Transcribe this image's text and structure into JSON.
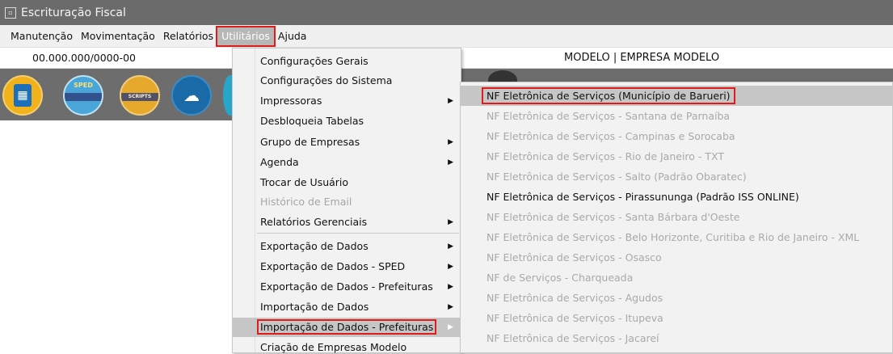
{
  "window": {
    "title": "Escrituração Fiscal",
    "icon": "app-window-icon"
  },
  "menubar": {
    "items": [
      {
        "label": "Manutenção"
      },
      {
        "label": "Movimentação"
      },
      {
        "label": "Relatórios"
      },
      {
        "label": "Utilitários",
        "active": true
      },
      {
        "label": "Ajuda"
      }
    ]
  },
  "info": {
    "cnpj": "00.000.000/0000-00",
    "empresa": "MODELO | EMPRESA MODELO"
  },
  "toolbar": {
    "buttons": [
      {
        "icon": "building-icon"
      },
      {
        "icon": "sped-contribuicoes-icon",
        "label": "SPED"
      },
      {
        "icon": "efd-icon",
        "label": "SCRIPTS"
      },
      {
        "icon": "cloud-download-icon"
      },
      {
        "icon": "partial-app-icon"
      }
    ]
  },
  "utilitarios_menu": [
    {
      "label": "Configurações Gerais",
      "disabled": false,
      "submenu": false
    },
    {
      "label": "Configurações do Sistema",
      "disabled": false,
      "submenu": false
    },
    {
      "label": "Impressoras",
      "disabled": false,
      "submenu": true
    },
    {
      "label": "Desbloqueia Tabelas",
      "disabled": false,
      "submenu": false
    },
    {
      "label": "Grupo de Empresas",
      "disabled": false,
      "submenu": true
    },
    {
      "label": "Agenda",
      "disabled": false,
      "submenu": true
    },
    {
      "label": "Trocar de Usuário",
      "disabled": false,
      "submenu": false
    },
    {
      "label": "Histórico de Email",
      "disabled": true,
      "submenu": false
    },
    {
      "label": "Relatórios Gerenciais",
      "disabled": false,
      "submenu": true
    },
    {
      "label": "Exportação de Dados",
      "disabled": false,
      "submenu": true
    },
    {
      "label": "Exportação de Dados - SPED",
      "disabled": false,
      "submenu": true
    },
    {
      "label": "Exportação de Dados - Prefeituras",
      "disabled": false,
      "submenu": true
    },
    {
      "label": "Importação de Dados",
      "disabled": false,
      "submenu": true
    },
    {
      "label": "Importação de Dados - Prefeituras",
      "disabled": false,
      "submenu": true,
      "highlighted": true
    },
    {
      "label": "Criação de Empresas Modelo",
      "disabled": false,
      "submenu": false
    }
  ],
  "prefeituras_submenu": [
    {
      "label": "NF Eletrônica de Serviços (Município de Barueri)",
      "disabled": false,
      "highlighted": true
    },
    {
      "label": "NF Eletrônica de Serviços - Santana de Parnaíba",
      "disabled": true
    },
    {
      "label": "NF Eletrônica de Serviços - Campinas e Sorocaba",
      "disabled": true
    },
    {
      "label": "NF Eletrônica de Serviços - Rio de Janeiro - TXT",
      "disabled": true
    },
    {
      "label": "NF Eletrônica de Serviços - Salto (Padrão Obaratec)",
      "disabled": true
    },
    {
      "label": "NF Eletrônica de Serviços - Pirassununga (Padrão ISS ONLINE)",
      "disabled": false
    },
    {
      "label": "NF Eletrônica de Serviços - Santa Bárbara d'Oeste",
      "disabled": true
    },
    {
      "label": "NF Eletrônica de Serviços - Belo Horizonte, Curitiba e Rio de Janeiro - XML",
      "disabled": true
    },
    {
      "label": "NF Eletrônica de Serviços - Osasco",
      "disabled": true
    },
    {
      "label": "NF de Serviços - Charqueada",
      "disabled": true
    },
    {
      "label": "NF Eletrônica de Serviços - Agudos",
      "disabled": true
    },
    {
      "label": "NF Eletrônica de Serviços - Itupeva",
      "disabled": true
    },
    {
      "label": "NF Eletrônica de Serviços - Jacareí",
      "disabled": true
    }
  ],
  "colors": {
    "highlight_border": "#e01b1b",
    "titlebar": "#6b6b6b",
    "toolbar": "#6d6d6d"
  }
}
